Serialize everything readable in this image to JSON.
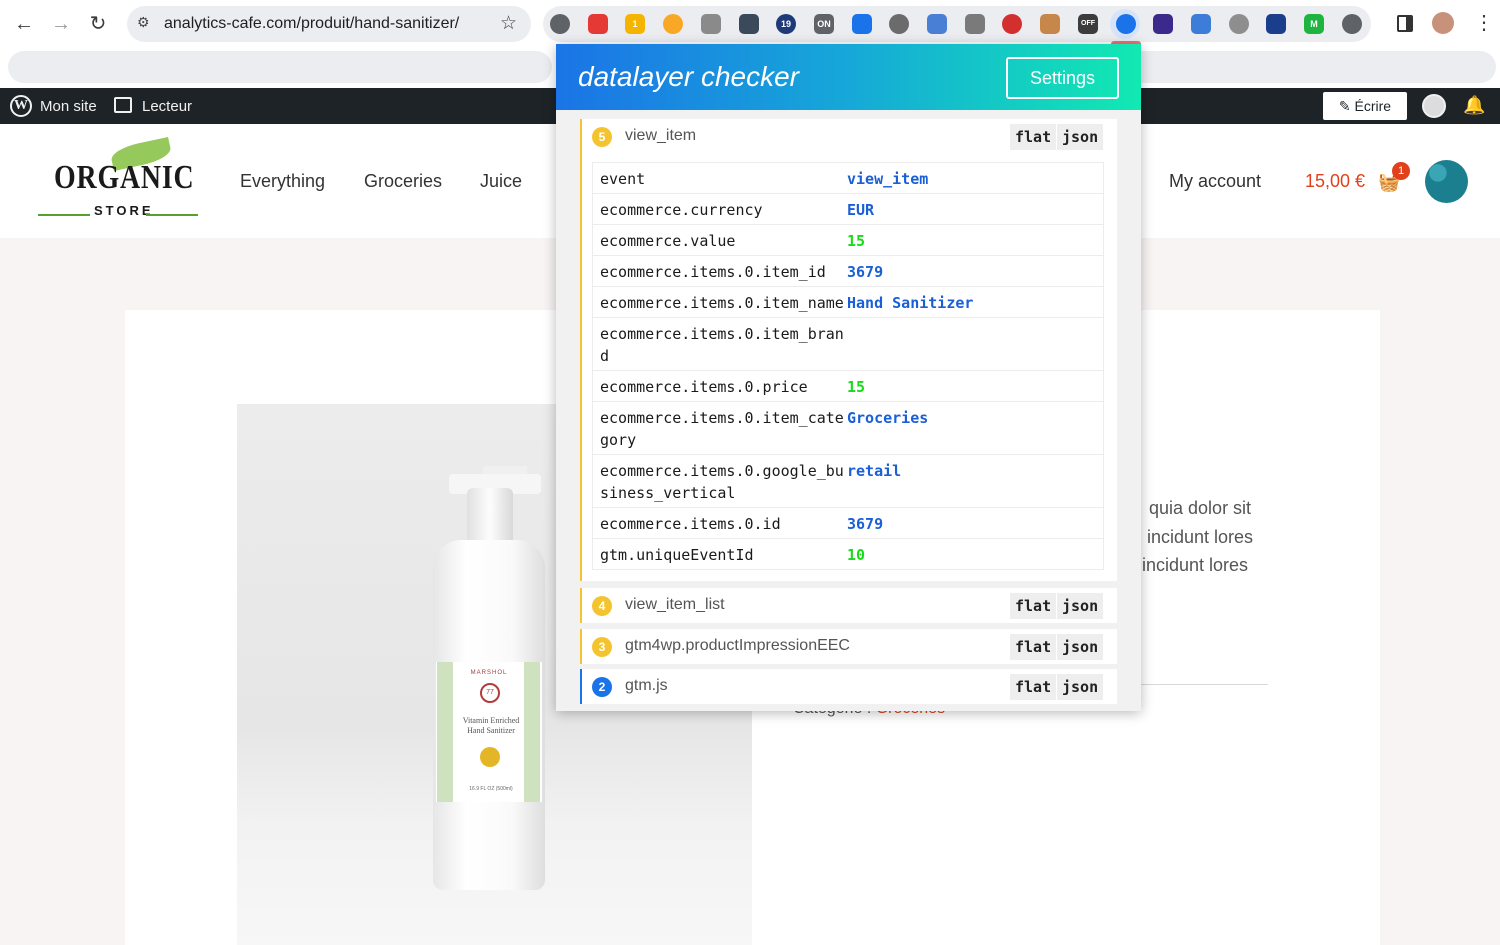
{
  "browser": {
    "url": "analytics-cafe.com/produit/hand-sanitizer/",
    "extensions": [
      {
        "icon": "code-icon",
        "color": "#5f6368",
        "label": ""
      },
      {
        "icon": "youtube-icon",
        "color": "#e53935",
        "label": ""
      },
      {
        "icon": "tag-assistant-icon",
        "color": "#f4b400",
        "label": "1"
      },
      {
        "icon": "duck-icon",
        "color": "#f9a825",
        "label": ""
      },
      {
        "icon": "gear-icon",
        "color": "#8a8a8a",
        "label": ""
      },
      {
        "icon": "compass-icon",
        "color": "#3b4a5a",
        "label": ""
      },
      {
        "icon": "w3-icon",
        "color": "#1e3a78",
        "label": "19"
      },
      {
        "icon": "cloud-icon",
        "color": "#5f6368",
        "label": "ON"
      },
      {
        "icon": "tag-icon",
        "color": "#1a73e8",
        "label": ""
      },
      {
        "icon": "globe-icon",
        "color": "#6b6b6b",
        "label": ""
      },
      {
        "icon": "window-icon",
        "color": "#4a7fd6",
        "label": ""
      },
      {
        "icon": "link-icon",
        "color": "#7a7a7a",
        "label": ""
      },
      {
        "icon": "red-square-icon",
        "color": "#d32f2f",
        "label": ""
      },
      {
        "icon": "cookie-icon",
        "color": "#c8874a",
        "label": ""
      },
      {
        "icon": "off-icon",
        "color": "#3c3c3c",
        "label": "OFF"
      },
      {
        "icon": "eye-icon",
        "color": "#1a73e8",
        "label": ""
      },
      {
        "icon": "layers-icon",
        "color": "#3b2a8c",
        "label": ""
      },
      {
        "icon": "star-burst-icon",
        "color": "#3b7dd8",
        "label": ""
      },
      {
        "icon": "colorful-icon",
        "color": "#8e8e8e",
        "label": ""
      },
      {
        "icon": "alien-icon",
        "color": "#1a3d8c",
        "label": ""
      },
      {
        "icon": "m-icon",
        "color": "#1db53f",
        "label": "M"
      },
      {
        "icon": "puzzle-icon",
        "color": "#5f6368",
        "label": ""
      }
    ]
  },
  "wpbar": {
    "mysite": "Mon site",
    "reader": "Lecteur",
    "write": "Écrire"
  },
  "site": {
    "logo": {
      "word": "ORGANIC",
      "sub": "STORE"
    },
    "nav": [
      "Everything",
      "Groceries",
      "Juice"
    ],
    "account": "My account",
    "cart_total": "15,00 €",
    "cart_count": "1"
  },
  "product": {
    "label": {
      "brand": "MARSHOL",
      "seal": "77",
      "line1": "Vitamin Enriched",
      "line2": "Hand Sanitizer",
      "size": "16.9 FL OZ (500ml)"
    },
    "description": [
      "quia dolor sit",
      "incidunt lores",
      "incidunt lores"
    ],
    "category_label": "Catégorie :",
    "category_value": "Groceries"
  },
  "popup": {
    "title": "datalayer checker",
    "settings": "Settings",
    "flat": "flat",
    "json": "json",
    "events": [
      {
        "index": "5",
        "name": "view_item",
        "rows": [
          {
            "key": "event",
            "value": "view_item",
            "type": "str"
          },
          {
            "key": "ecommerce.currency",
            "value": "EUR",
            "type": "str"
          },
          {
            "key": "ecommerce.value",
            "value": "15",
            "type": "num"
          },
          {
            "key": "ecommerce.items.0.item_id",
            "value": "3679",
            "type": "str"
          },
          {
            "key": "ecommerce.items.0.item_name",
            "value": "Hand Sanitizer",
            "type": "str"
          },
          {
            "key": "ecommerce.items.0.item_brand",
            "value": "",
            "type": "str"
          },
          {
            "key": "ecommerce.items.0.price",
            "value": "15",
            "type": "num"
          },
          {
            "key": "ecommerce.items.0.item_category",
            "value": "Groceries",
            "type": "str"
          },
          {
            "key": "ecommerce.items.0.google_business_vertical",
            "value": "retail",
            "type": "str"
          },
          {
            "key": "ecommerce.items.0.id",
            "value": "3679",
            "type": "str"
          },
          {
            "key": "gtm.uniqueEventId",
            "value": "10",
            "type": "num"
          }
        ]
      },
      {
        "index": "4",
        "name": "view_item_list"
      },
      {
        "index": "3",
        "name": "gtm4wp.productImpressionEEC"
      },
      {
        "index": "2",
        "name": "gtm.js"
      }
    ]
  }
}
